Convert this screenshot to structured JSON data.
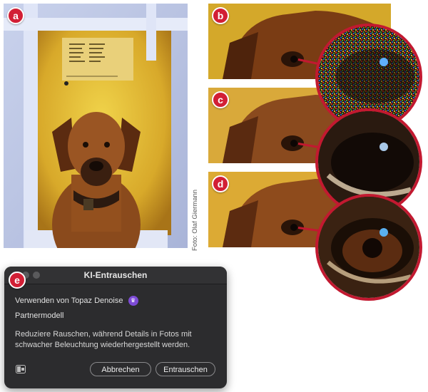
{
  "badges": {
    "a": "a",
    "b": "b",
    "c": "c",
    "d": "d",
    "e": "e"
  },
  "photo_credit": "Foto: Olaf Giermann",
  "dialog": {
    "title": "KI-Entrauschen",
    "option_label": "Verwenden von Topaz Denoise",
    "option_badge_icon": "crown-icon",
    "option_badge_color": "#7d4bd6",
    "partner_label": "Partnermodell",
    "description": "Reduziere Rauschen, während Details in Fotos mit schwacher Beleuchtung wiederhergestellt werden.",
    "cancel_label": "Abbrechen",
    "confirm_label": "Entrauschen"
  },
  "colors": {
    "accent_red": "#c21930",
    "dialog_bg": "#2c2c2e"
  }
}
